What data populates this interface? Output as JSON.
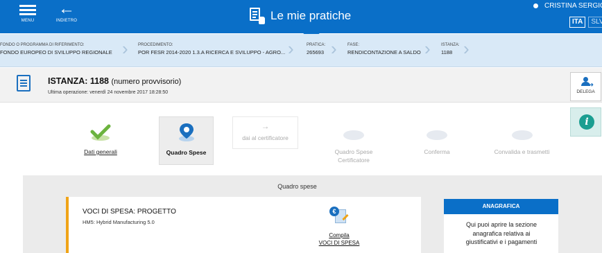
{
  "header": {
    "menu_label": "MENU",
    "back_label": "INDIETRO",
    "title": "Le mie pratiche",
    "user": "CRISTINA SERGIO",
    "languages": [
      "ITA",
      "SLV"
    ],
    "active_language": "ITA",
    "brand_color": "#0a6fc8"
  },
  "breadcrumb": [
    {
      "key": "FONDO O PROGRAMMA DI RIFERIMENTO:",
      "value": "FONDO EUROPEO DI SVILUPPO REGIONALE"
    },
    {
      "key": "PROCEDIMENTO:",
      "value": "POR FESR 2014-2020 1.3.A RICERCA E SVILUPPO - AGRO..."
    },
    {
      "key": "PRATICA:",
      "value": "265693"
    },
    {
      "key": "FASE:",
      "value": "RENDICONTAZIONE A SALDO"
    },
    {
      "key": "ISTANZA:",
      "value": "1188"
    }
  ],
  "istanza": {
    "title": "ISTANZA: 1188",
    "title_note": "(numero provvisorio)",
    "last_op": "Ultima operazione: venerdì 24 novembre 2017 18:28:50"
  },
  "actions": {
    "delega": "DELEGA",
    "info_icon": "info-icon"
  },
  "steps": [
    {
      "label": "Dati generali",
      "state": "done",
      "icon": "checkmark-icon"
    },
    {
      "label": "Quadro Spese",
      "state": "active",
      "icon": "map-pin-icon"
    },
    {
      "label": "dai al certificatore",
      "state": "disabled",
      "icon": "arrow-right-icon"
    },
    {
      "label": "Quadro Spese Certificatore",
      "state": "disabled",
      "icon": "blob-icon"
    },
    {
      "label": "Conferma",
      "state": "disabled",
      "icon": "blob-icon"
    },
    {
      "label": "Convalida e trasmetti",
      "state": "disabled",
      "icon": "blob-icon"
    }
  ],
  "panel": {
    "title": "Quadro spese",
    "card": {
      "title": "VOCI DI SPESA: PROGETTO",
      "subtitle": "HM5: Hybrid Manufacturing 5.0",
      "link_line1": "Compila",
      "link_line2": "VOCI DI SPESA",
      "accent": "#f0a417"
    },
    "anagrafica": {
      "header": "ANAGRAFICA",
      "body": "Qui puoi aprire la sezione anagrafica relativa ai giustificativi e i pagamenti"
    }
  }
}
